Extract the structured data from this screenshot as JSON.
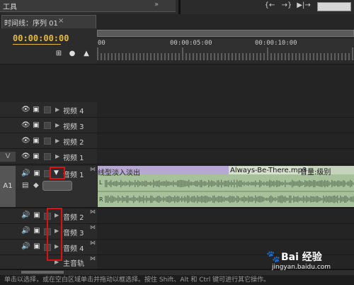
{
  "top": {
    "panel_label": "工具",
    "transport_buttons": [
      "{←",
      "→}",
      "▶|→"
    ]
  },
  "timeline": {
    "tab_title": "时间线：序列 01",
    "tab_close": "×",
    "timecode": "00:00:00:00",
    "ruler_labels": [
      "00",
      "00:00:05:00",
      "00:00:10:00"
    ]
  },
  "tracks": {
    "video": [
      {
        "name": "视频 4",
        "tag": ""
      },
      {
        "name": "视频 3",
        "tag": ""
      },
      {
        "name": "视频 2",
        "tag": ""
      },
      {
        "name": "视频 1",
        "tag": "V"
      }
    ],
    "audio1": {
      "tag": "A1",
      "name": "音频 1"
    },
    "audio": [
      {
        "name": "音频 2"
      },
      {
        "name": "音频 3"
      },
      {
        "name": "音频 4"
      }
    ],
    "master": {
      "name": "主音轨"
    }
  },
  "clip": {
    "left_label": "线型淡入淡出",
    "name": "Always-Be-There.mp3",
    "volume_label": "音量:级别",
    "color": "#a7c29a"
  },
  "status_text": "单击以选择，或在空白区域单击并拖动以框选择。按住 Shift、Alt 和 Ctrl 键可进行其它操作。",
  "watermark": {
    "brand": "Bai 经验",
    "site": "jingyan.baidu.com"
  },
  "highlight_color": "#d11111"
}
